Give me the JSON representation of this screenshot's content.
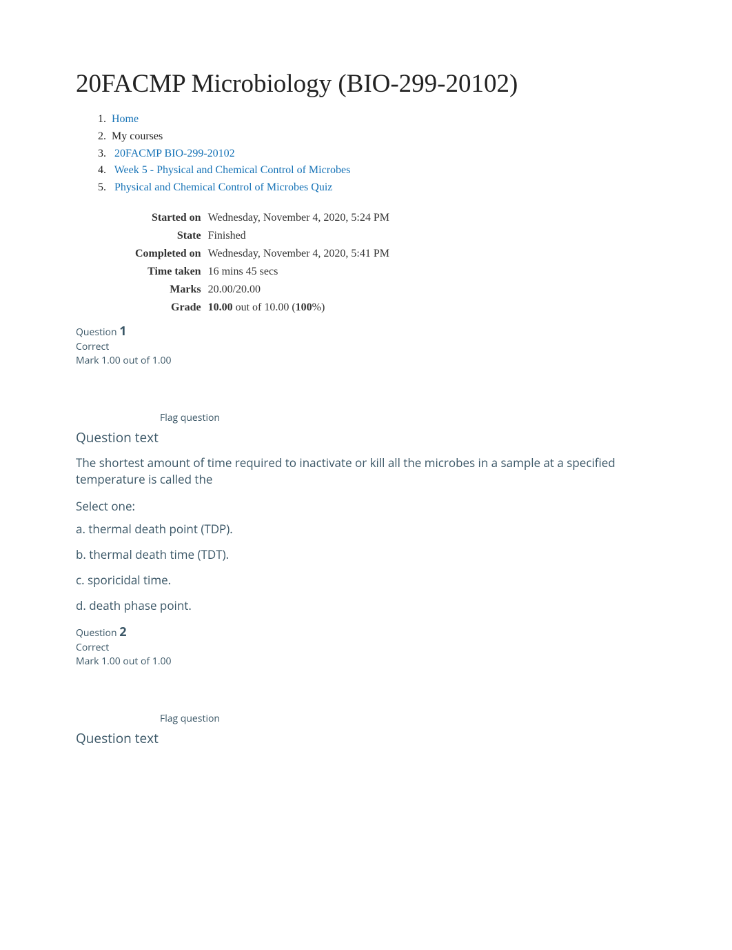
{
  "course_title": "20FACMP Microbiology (BIO-299-20102)",
  "breadcrumb": {
    "items": [
      {
        "label": "Home",
        "link": true,
        "prefix": ""
      },
      {
        "label": "My courses",
        "link": false,
        "prefix": ""
      },
      {
        "label": "20FACMP BIO-299-20102",
        "link": true,
        "prefix": " "
      },
      {
        "label": "Week 5 - Physical and Chemical Control of Microbes",
        "link": true,
        "prefix": " "
      },
      {
        "label": "Physical and Chemical Control of Microbes Quiz",
        "link": true,
        "prefix": " "
      }
    ]
  },
  "summary": {
    "rows": [
      {
        "label": "Started on",
        "value": "Wednesday, November 4, 2020, 5:24 PM"
      },
      {
        "label": "State",
        "value": "Finished"
      },
      {
        "label": "Completed on",
        "value": "Wednesday, November 4, 2020, 5:41 PM"
      },
      {
        "label": "Time taken",
        "value": "16 mins 45 secs"
      },
      {
        "label": "Marks",
        "value": "20.00/20.00"
      }
    ],
    "grade_label": "Grade",
    "grade_value_strong1": "10.00",
    "grade_value_mid": " out of 10.00 (",
    "grade_value_strong2": "100",
    "grade_value_tail": "%)"
  },
  "questions": [
    {
      "meta_prefix": "Question ",
      "number": "1",
      "state": "Correct",
      "mark": "Mark 1.00 out of 1.00",
      "flag_label": "Flag question",
      "heading": "Question text",
      "prompt": "The shortest amount of time required to inactivate or kill all the microbes in a sample at a specified temperature is called the",
      "select_one": "Select one:",
      "options": [
        "a. thermal death point (TDP).",
        "b. thermal death time (TDT).",
        "c. sporicidal time.",
        "d. death phase point."
      ]
    },
    {
      "meta_prefix": "Question ",
      "number": "2",
      "state": "Correct",
      "mark": "Mark 1.00 out of 1.00",
      "flag_label": "Flag question",
      "heading": "Question text"
    }
  ]
}
